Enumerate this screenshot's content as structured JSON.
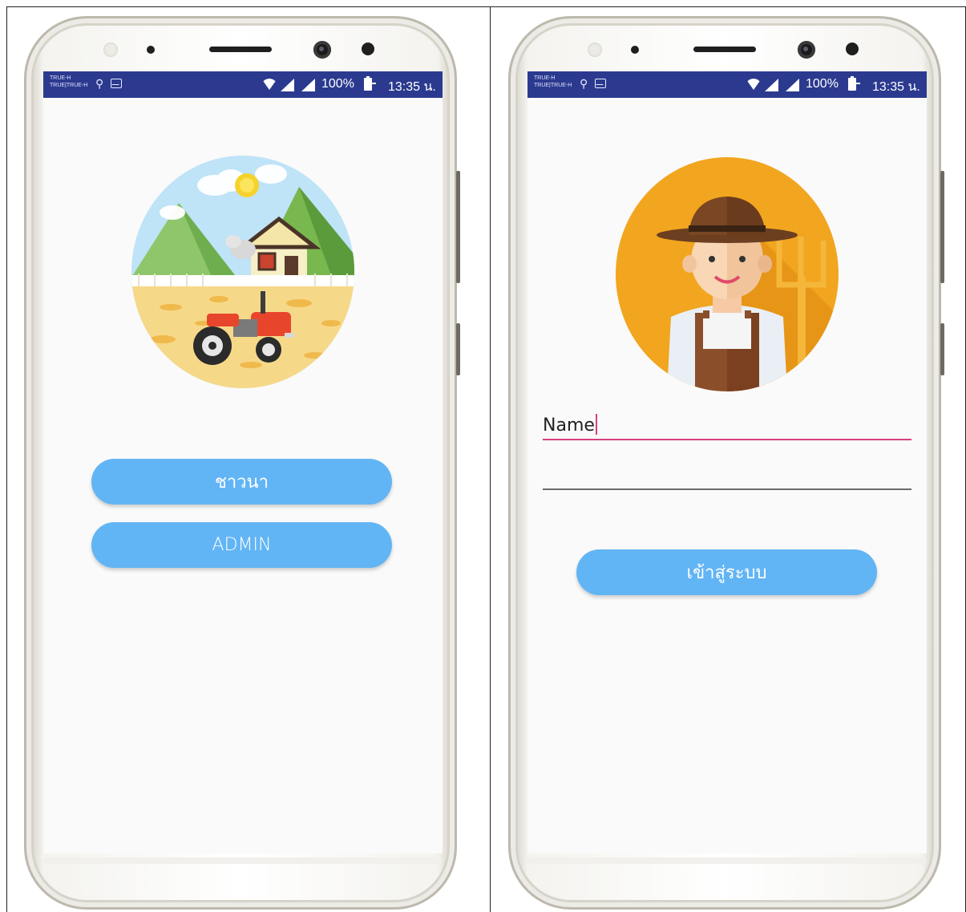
{
  "status_bar": {
    "carrier_line1": "TRUE-H",
    "carrier_line2": "TRUE|TRUE-H",
    "battery": "100%",
    "time": "13:35 น."
  },
  "screens": {
    "role_select": {
      "farmer_button": "ชาวนา",
      "admin_button": "ADMIN",
      "illustration": "farm-tractor-illustration"
    },
    "login": {
      "name_value": "Name",
      "password_value": "",
      "login_button": "เข้าสู่ระบบ",
      "illustration": "farmer-avatar-illustration"
    }
  },
  "colors": {
    "status_bar": "#2b3a8f",
    "button": "#62b5f5",
    "input_focus": "#d8407e"
  }
}
